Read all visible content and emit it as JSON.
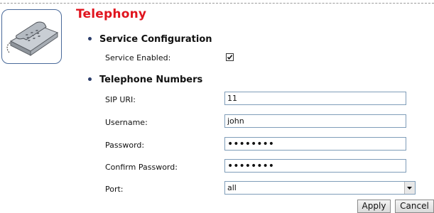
{
  "page": {
    "title": "Telephony"
  },
  "sections": {
    "service": {
      "heading": "Service Configuration",
      "enabled_label": "Service Enabled:",
      "enabled_checked": true
    },
    "numbers": {
      "heading": "Telephone Numbers",
      "sip_uri_label": "SIP URI:",
      "sip_uri_value": "11",
      "username_label": "Username:",
      "username_value": "john",
      "password_label": "Password:",
      "password_value": "••••••••",
      "confirm_label": "Confirm Password:",
      "confirm_value": "••••••••",
      "port_label": "Port:",
      "port_value": "all"
    }
  },
  "buttons": {
    "apply": "Apply",
    "cancel": "Cancel"
  },
  "icons": {
    "header": "telephone-icon",
    "dropdown": "chevron-down-icon",
    "check": "checkmark-icon"
  },
  "colors": {
    "title": "#e0141e",
    "border": "#4a6a9a",
    "bullet": "#2b3d6b"
  }
}
